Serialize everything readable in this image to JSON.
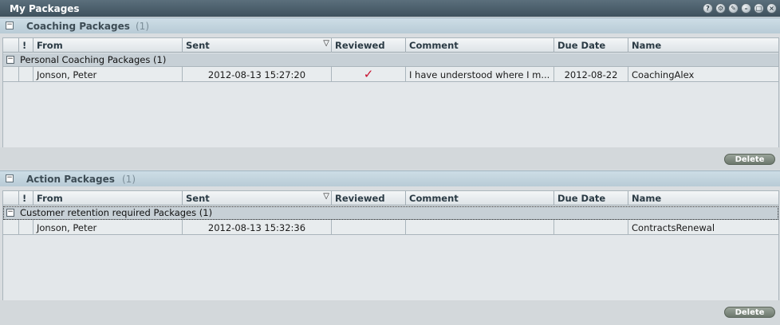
{
  "window": {
    "title": "My Packages"
  },
  "columns": {
    "flag": "!",
    "from": "From",
    "sent": "Sent",
    "reviewed": "Reviewed",
    "comment": "Comment",
    "due_date": "Due Date",
    "name": "Name"
  },
  "coaching": {
    "title": "Coaching Packages",
    "count": "(1)",
    "group_label": "Personal Coaching Packages (1)",
    "row": {
      "from": "Jonson, Peter",
      "sent": "2012-08-13 15:27:20",
      "reviewed": "✓",
      "comment": "I have understood where I m...",
      "due_date": "2012-08-22",
      "name": "CoachingAlex"
    },
    "delete_label": "Delete"
  },
  "action": {
    "title": "Action Packages",
    "count": "(1)",
    "group_label": "Customer retention required Packages (1)",
    "row": {
      "from": "Jonson, Peter",
      "sent": "2012-08-13 15:32:36",
      "reviewed": "",
      "comment": "",
      "due_date": "",
      "name": "ContractsRenewal"
    },
    "delete_label": "Delete"
  },
  "colors": {
    "titlebar": "#3e515d",
    "section_header": "#b8cbd6",
    "check": "#c8102e"
  },
  "icons": [
    "help-icon",
    "settings-icon",
    "edit-icon",
    "minimize-icon",
    "maximize-icon",
    "close-icon",
    "collapse-icon",
    "sort-desc-icon",
    "check-icon"
  ]
}
